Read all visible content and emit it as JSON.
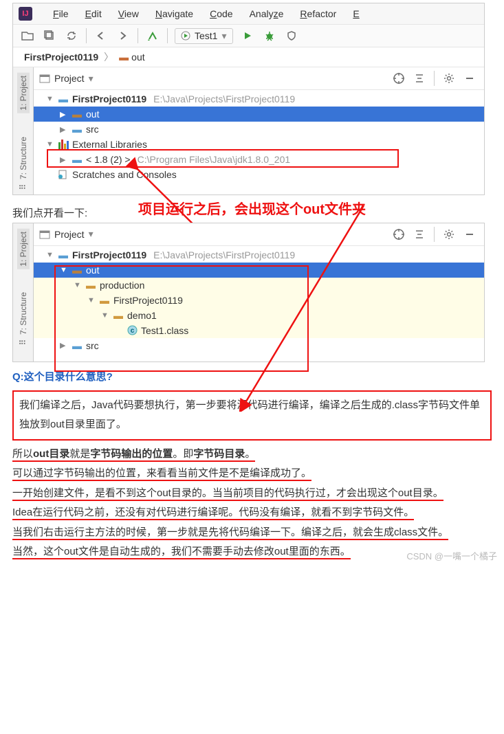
{
  "menu": {
    "file": "File",
    "edit": "Edit",
    "view": "View",
    "navigate": "Navigate",
    "code": "Code",
    "analyze": "Analyze",
    "refactor": "Refactor",
    "last": "E"
  },
  "toolbar": {
    "run_config": "Test1"
  },
  "breadcrumb": {
    "project": "FirstProject0119",
    "folder": "out"
  },
  "side": {
    "project": "1: Project",
    "structure": "7: Structure"
  },
  "panel": {
    "title": "Project"
  },
  "tree1": {
    "root_name": "FirstProject0119",
    "root_path": "E:\\Java\\Projects\\FirstProject0119",
    "out": "out",
    "src": "src",
    "ext_libs": "External Libraries",
    "jdk": "< 1.8 (2) >",
    "jdk_path": "C:\\Program Files\\Java\\jdk1.8.0_201",
    "scratches": "Scratches and Consoles"
  },
  "intro": "我们点开看一下:",
  "annotation": "项目运行之后，会出现这个out文件夹",
  "tree2": {
    "root_name": "FirstProject0119",
    "root_path": "E:\\Java\\Projects\\FirstProject0119",
    "out": "out",
    "production": "production",
    "proj": "FirstProject0119",
    "demo1": "demo1",
    "class_file": "Test1.class",
    "src": "src"
  },
  "qa_label": "Q:这个目录什么意思?",
  "explain": {
    "p1": "我们编译之后，Java代码要想执行，第一步要将源代码进行编译，编译之后生成的.class字节码文件单独放到out目录里面了。",
    "p2a": "所以",
    "p2b": "out目录",
    "p2c": "就是",
    "p2d": "字节码输出的位置",
    "p2e": "。即",
    "p2f": "字节码目录",
    "p2g": "。",
    "p3": "可以通过字节码输出的位置，来看看当前文件是不是编译成功了。",
    "p4": "一开始创建文件，是看不到这个out目录的。当当前项目的代码执行过，才会出现这个out目录。",
    "p5": "Idea在运行代码之前，还没有对代码进行编译呢。代码没有编译，就看不到字节码文件。",
    "p6": "当我们右击运行主方法的时候，第一步就是先将代码编译一下。编译之后，就会生成class文件。",
    "p7": "当然，这个out文件是自动生成的，我们不需要手动去修改out里面的东西。"
  },
  "watermark": "CSDN @一嘴一个橘子"
}
